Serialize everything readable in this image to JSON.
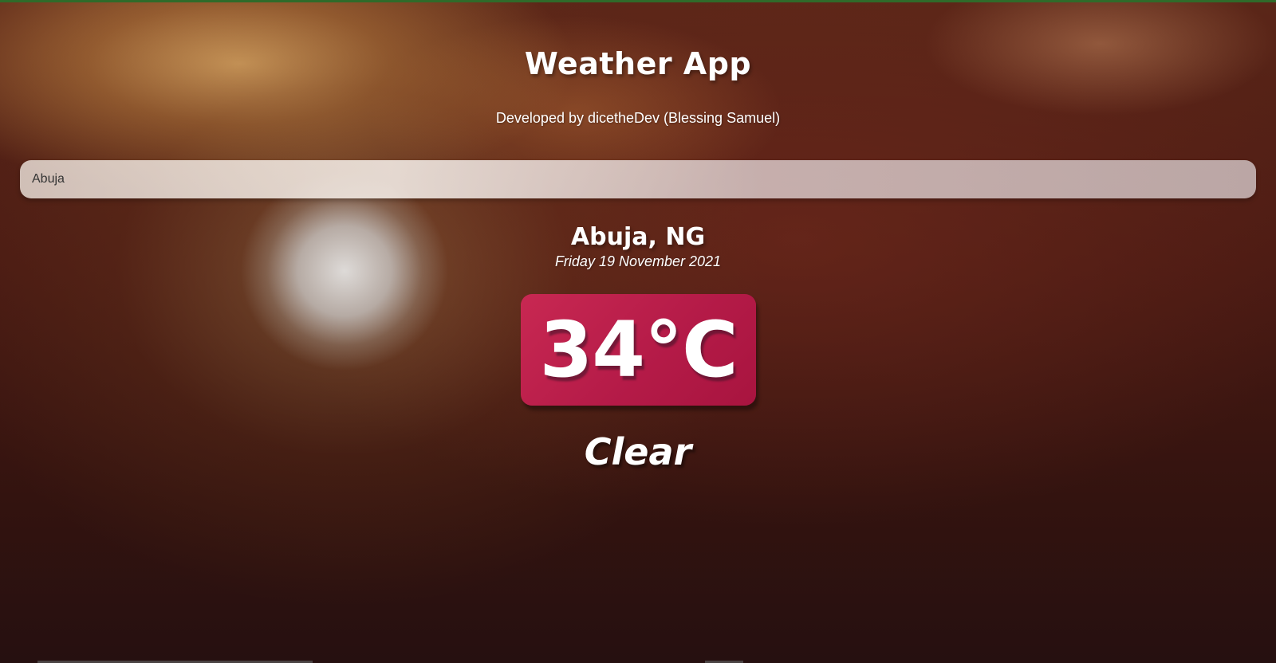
{
  "app": {
    "title": "Weather App",
    "subtitle": "Developed by dicetheDev (Blessing Samuel)"
  },
  "search": {
    "value": "Abuja",
    "placeholder": ""
  },
  "weather": {
    "location": "Abuja, NG",
    "date": "Friday 19 November 2021",
    "temperature": "34°C",
    "condition": "Clear"
  },
  "colors": {
    "temperature_box": "#b51b48",
    "text": "#ffffff",
    "top_border": "#2f6b2a"
  }
}
